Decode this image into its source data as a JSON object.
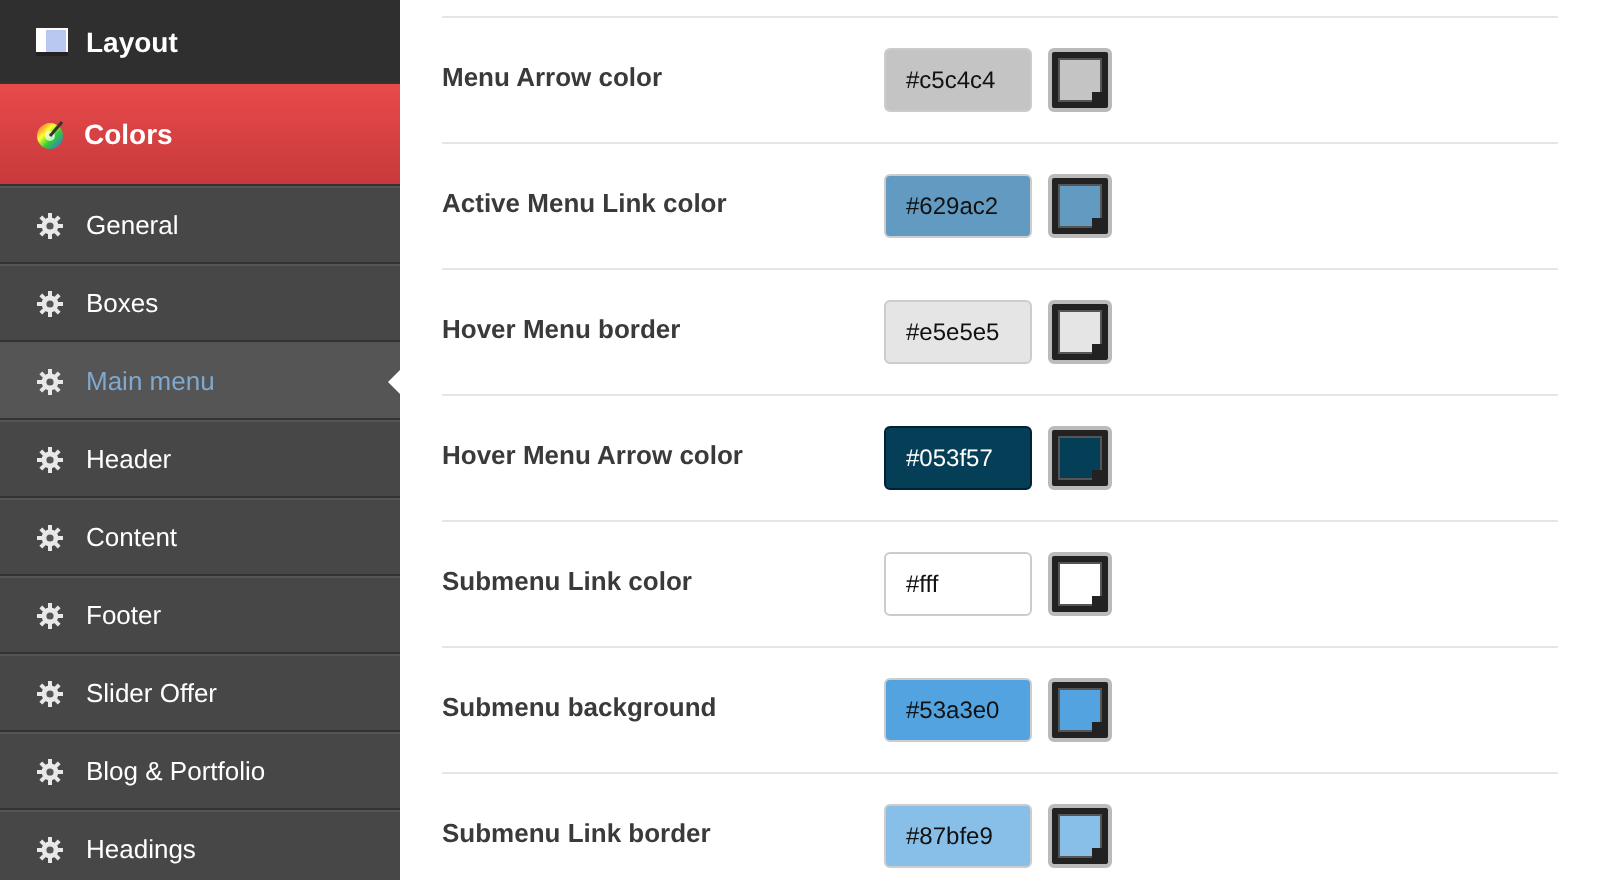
{
  "sidebar": {
    "items": [
      {
        "label": "Layout",
        "kind": "section",
        "selected": false
      },
      {
        "label": "Colors",
        "kind": "section",
        "selected": true
      },
      {
        "label": "General",
        "kind": "subitem",
        "selected": false
      },
      {
        "label": "Boxes",
        "kind": "subitem",
        "selected": false
      },
      {
        "label": "Main menu",
        "kind": "subitem",
        "selected": true
      },
      {
        "label": "Header",
        "kind": "subitem",
        "selected": false
      },
      {
        "label": "Content",
        "kind": "subitem",
        "selected": false
      },
      {
        "label": "Footer",
        "kind": "subitem",
        "selected": false
      },
      {
        "label": "Slider Offer",
        "kind": "subitem",
        "selected": false
      },
      {
        "label": "Blog & Portfolio",
        "kind": "subitem",
        "selected": false
      },
      {
        "label": "Headings",
        "kind": "subitem",
        "selected": false
      }
    ]
  },
  "settings": [
    {
      "label": "Menu Arrow color",
      "value": "#c5c4c4",
      "color": "#c5c4c4"
    },
    {
      "label": "Active Menu Link color",
      "value": "#629ac2",
      "color": "#629ac2"
    },
    {
      "label": "Hover Menu border",
      "value": "#e5e5e5",
      "color": "#e5e5e5"
    },
    {
      "label": "Hover Menu Arrow color",
      "value": "#053f57",
      "color": "#053f57"
    },
    {
      "label": "Submenu Link color",
      "value": "#fff",
      "color": "#ffffff"
    },
    {
      "label": "Submenu background",
      "value": "#53a3e0",
      "color": "#53a3e0"
    },
    {
      "label": "Submenu Link border",
      "value": "#87bfe9",
      "color": "#87bfe9"
    }
  ]
}
